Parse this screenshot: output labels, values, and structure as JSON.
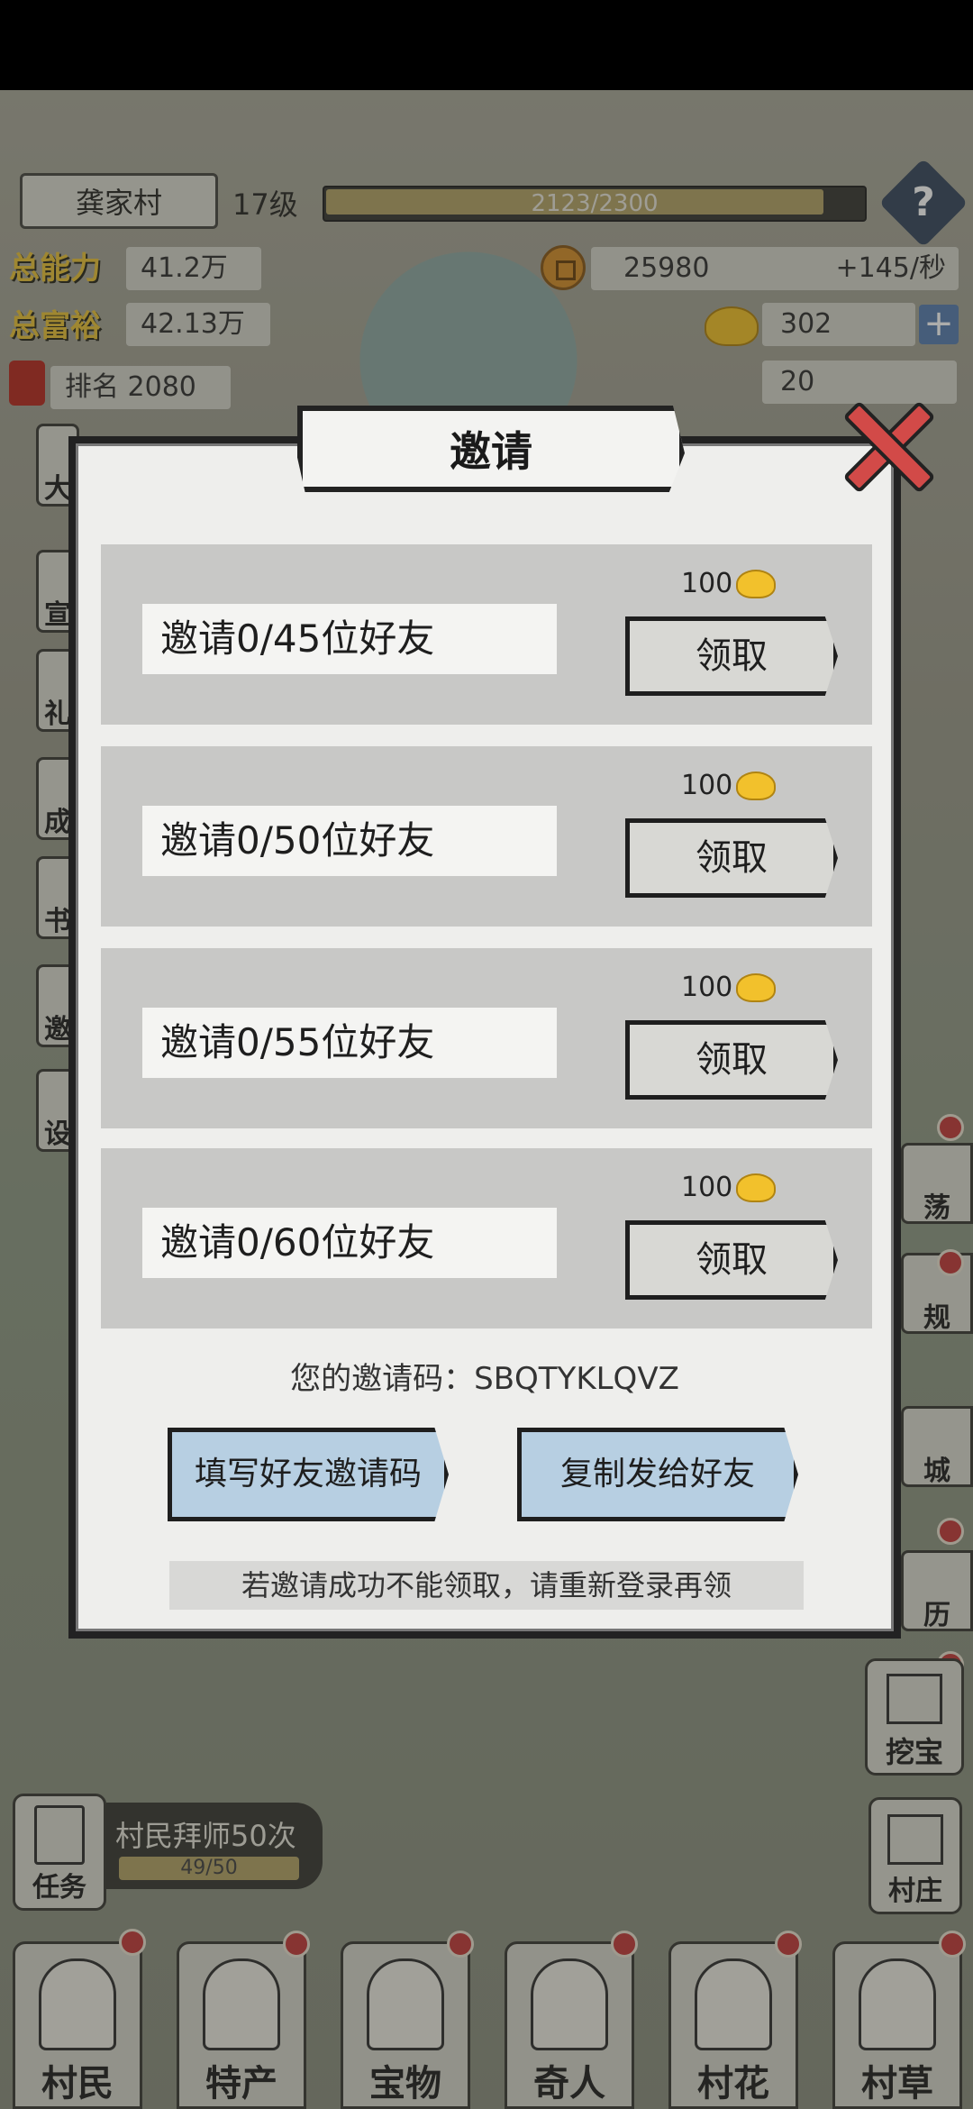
{
  "hud": {
    "village_name": "龚家村",
    "level": "17级",
    "exp_text": "2123/2300",
    "exp_progress": 0.923,
    "total_ability_label": "总能力",
    "total_ability": "41.2万",
    "total_wealth_label": "总富裕",
    "total_wealth": "42.13万",
    "rank": "排名 2080",
    "coins": "25980",
    "coin_rate": "+145/秒",
    "gold": "302",
    "tickets": "20"
  },
  "left_side": [
    "大",
    "宣",
    "礼",
    "成",
    "书",
    "邀",
    "设"
  ],
  "right_side": [
    "荡",
    "规",
    "城",
    "历"
  ],
  "dialog": {
    "title": "邀请",
    "rows": [
      {
        "reward": "100",
        "label": "邀请0/45位好友",
        "button": "领取"
      },
      {
        "reward": "100",
        "label": "邀请0/50位好友",
        "button": "领取"
      },
      {
        "reward": "100",
        "label": "邀请0/55位好友",
        "button": "领取"
      },
      {
        "reward": "100",
        "label": "邀请0/60位好友",
        "button": "领取"
      }
    ],
    "invite_code_text": "您的邀请码：SBQTYKLQVZ",
    "fill_code_button": "填写好友邀请码",
    "copy_button": "复制发给好友",
    "notice": "若邀请成功不能领取，请重新登录再领"
  },
  "task": {
    "button": "任务",
    "title": "村民拜师50次",
    "progress": "49/50"
  },
  "dig_button": "挖宝",
  "village_button": "村庄",
  "tabs": [
    "村民",
    "特产",
    "宝物",
    "奇人",
    "村花",
    "村草"
  ]
}
